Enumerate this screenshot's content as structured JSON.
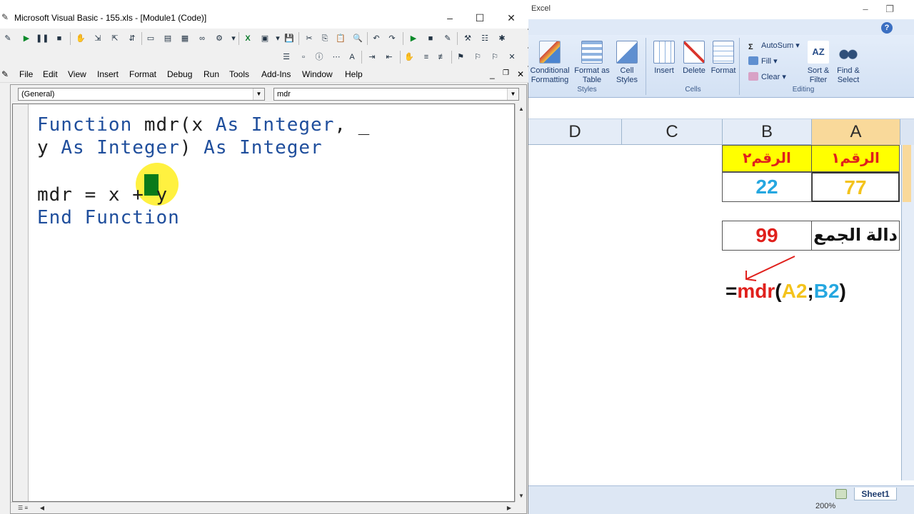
{
  "excel": {
    "title": "Excel",
    "ribbon": {
      "styles_group": {
        "label": "Styles",
        "conditional_formatting": "Conditional Formatting",
        "format_as_table": "Format as Table",
        "cell_styles": "Cell Styles"
      },
      "cells_group": {
        "label": "Cells",
        "insert": "Insert",
        "delete": "Delete",
        "format": "Format"
      },
      "editing_group": {
        "label": "Editing",
        "autosum": "AutoSum",
        "fill": "Fill",
        "clear": "Clear",
        "sort_filter": "Sort & Filter",
        "find_select": "Find & Select"
      }
    },
    "columns": [
      "D",
      "C",
      "B",
      "A"
    ],
    "cells": {
      "A1": "الرقم١",
      "B1": "الرقم٢",
      "A2": "77",
      "B2": "22",
      "A4": "دالة الجمع",
      "B4": "99"
    },
    "formula_note": {
      "eq": "=",
      "fn": "mdr",
      "open": "(",
      "arg1": "A2",
      "sep": ";",
      "arg2": "B2",
      "close": ")"
    },
    "colors": {
      "header_fill": "#ffff00",
      "header_text": "#e0201c",
      "a2_text": "#f4c31c",
      "b2_text": "#25a7e0",
      "result_text": "#e0201c"
    },
    "sheet_tab": "Sheet1",
    "zoom": "200%"
  },
  "vba": {
    "title": "Microsoft Visual Basic - 155.xls - [Module1 (Code)]",
    "menu": [
      "File",
      "Edit",
      "View",
      "Insert",
      "Format",
      "Debug",
      "Run",
      "Tools",
      "Add-Ins",
      "Window",
      "Help"
    ],
    "object_combo": "(General)",
    "procedure_combo": "mdr",
    "code": {
      "line1_kw1": "Function",
      "line1_rest": " mdr(x ",
      "line1_kw2": "As Integer",
      "line1_tail": ", _",
      "line2_pre": "y ",
      "line2_kw": "As Integer",
      "line2_mid": ") ",
      "line2_kw2": "As Integer",
      "line3": "mdr = x + y",
      "line4": "End Function"
    }
  }
}
